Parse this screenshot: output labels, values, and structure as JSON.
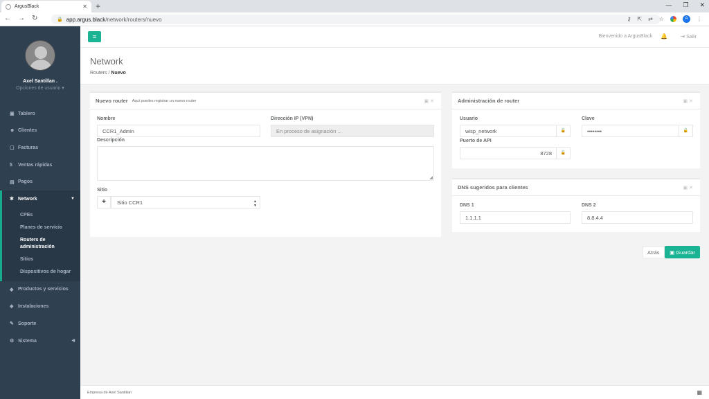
{
  "browser": {
    "tab_title": "ArgusBlack",
    "url_host": "app.argus.black",
    "url_path": "/network/routers/nuevo",
    "profile_initial": "A"
  },
  "sidebar": {
    "user_name": "Axel Santillan .",
    "user_options": "Opciones de usuario ▾",
    "items": [
      {
        "label": "Tablero",
        "icon": "dashboard-icon"
      },
      {
        "label": "Clientes",
        "icon": "users-icon"
      },
      {
        "label": "Facturas",
        "icon": "file-icon"
      },
      {
        "label": "Ventas rápidas",
        "icon": "dollar-icon"
      },
      {
        "label": "Pagos",
        "icon": "money-icon"
      }
    ],
    "network": {
      "label": "Network",
      "icon": "gear-icon",
      "sub": [
        "CPEs",
        "Planes de servicio",
        "Routers de administración",
        "Sitios",
        "Dispositivos de hogar"
      ]
    },
    "items2": [
      {
        "label": "Productos y servicios",
        "icon": "tag-icon"
      },
      {
        "label": "Instalaciones",
        "icon": "plug-icon"
      },
      {
        "label": "Soporte",
        "icon": "wrench-icon"
      },
      {
        "label": "Sistema",
        "icon": "cogs-icon"
      }
    ]
  },
  "topbar": {
    "welcome": "Bienvenido a ArgusBlack",
    "logout": "Salir"
  },
  "page": {
    "title": "Network",
    "crumb1": "Routers",
    "crumb2": "Nuevo"
  },
  "router_form": {
    "title": "Nuevo router",
    "subtitle": "Aquí puedes registrar un nuevo router",
    "name_label": "Nombre",
    "name_value": "CCR1_Admin",
    "ip_label": "Dirección IP (VPN)",
    "ip_placeholder": "En proceso de asignación ...",
    "desc_label": "Descripción",
    "site_label": "Sitio",
    "site_value": "Sitio CCR1"
  },
  "admin_box": {
    "title": "Administración de router",
    "user_label": "Usuario",
    "user_value": "wisp_network",
    "pass_label": "Clave",
    "pass_value": "••••••••",
    "api_label": "Puerto de API",
    "api_value": "8728"
  },
  "dns_box": {
    "title": "DNS sugeridos para clientes",
    "dns1_label": "DNS 1",
    "dns1_value": "1.1.1.1",
    "dns2_label": "DNS 2",
    "dns2_value": "8.8.4.4"
  },
  "actions": {
    "back": "Atrás",
    "save": "Guardar"
  },
  "footer": {
    "text": "Empresa de Axel Santillan"
  }
}
